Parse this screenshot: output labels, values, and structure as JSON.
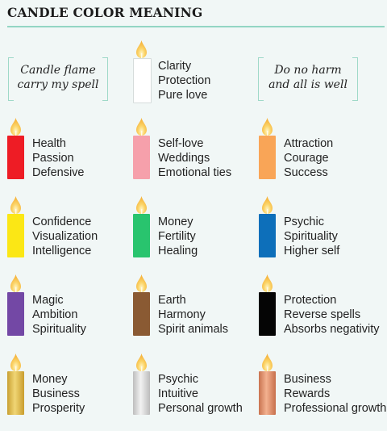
{
  "title": "CANDLE COLOR MEANING",
  "quotes": [
    {
      "line1": "Candle flame",
      "line2": "carry my spell"
    },
    {
      "line1": "Do no harm",
      "line2": "and all is well"
    }
  ],
  "candles": [
    {
      "color_name": "white",
      "color": "#ffffff",
      "meanings": [
        "Clarity",
        "Protection",
        "Pure love"
      ]
    },
    {
      "color_name": "red",
      "color": "#ee1c25",
      "meanings": [
        "Health",
        "Passion",
        "Defensive"
      ]
    },
    {
      "color_name": "pink",
      "color": "#f6a0ab",
      "meanings": [
        "Self-love",
        "Weddings",
        "Emotional ties"
      ]
    },
    {
      "color_name": "orange",
      "color": "#f9a557",
      "meanings": [
        "Attraction",
        "Courage",
        "Success"
      ]
    },
    {
      "color_name": "yellow",
      "color": "#fbe715",
      "meanings": [
        "Confidence",
        "Visualization",
        "Intelligence"
      ]
    },
    {
      "color_name": "green",
      "color": "#29c46e",
      "meanings": [
        "Money",
        "Fertility",
        "Healing"
      ]
    },
    {
      "color_name": "blue",
      "color": "#0d6fba",
      "meanings": [
        "Psychic",
        "Spirituality",
        "Higher self"
      ]
    },
    {
      "color_name": "purple",
      "color": "#7348a5",
      "meanings": [
        "Magic",
        "Ambition",
        "Spirituality"
      ]
    },
    {
      "color_name": "brown",
      "color": "#8a5a33",
      "meanings": [
        "Earth",
        "Harmony",
        "Spirit animals"
      ]
    },
    {
      "color_name": "black",
      "color": "#050505",
      "meanings": [
        "Protection",
        "Reverse spells",
        "Absorbs negativity"
      ]
    },
    {
      "color_name": "gold",
      "color": "#d9b53e",
      "meanings": [
        "Money",
        "Business",
        "Prosperity"
      ]
    },
    {
      "color_name": "silver",
      "color": "#d3d3d3",
      "meanings": [
        "Psychic",
        "Intuitive",
        "Personal growth"
      ]
    },
    {
      "color_name": "copper",
      "color": "#db8b65",
      "meanings": [
        "Business",
        "Rewards",
        "Professional growth"
      ]
    }
  ]
}
